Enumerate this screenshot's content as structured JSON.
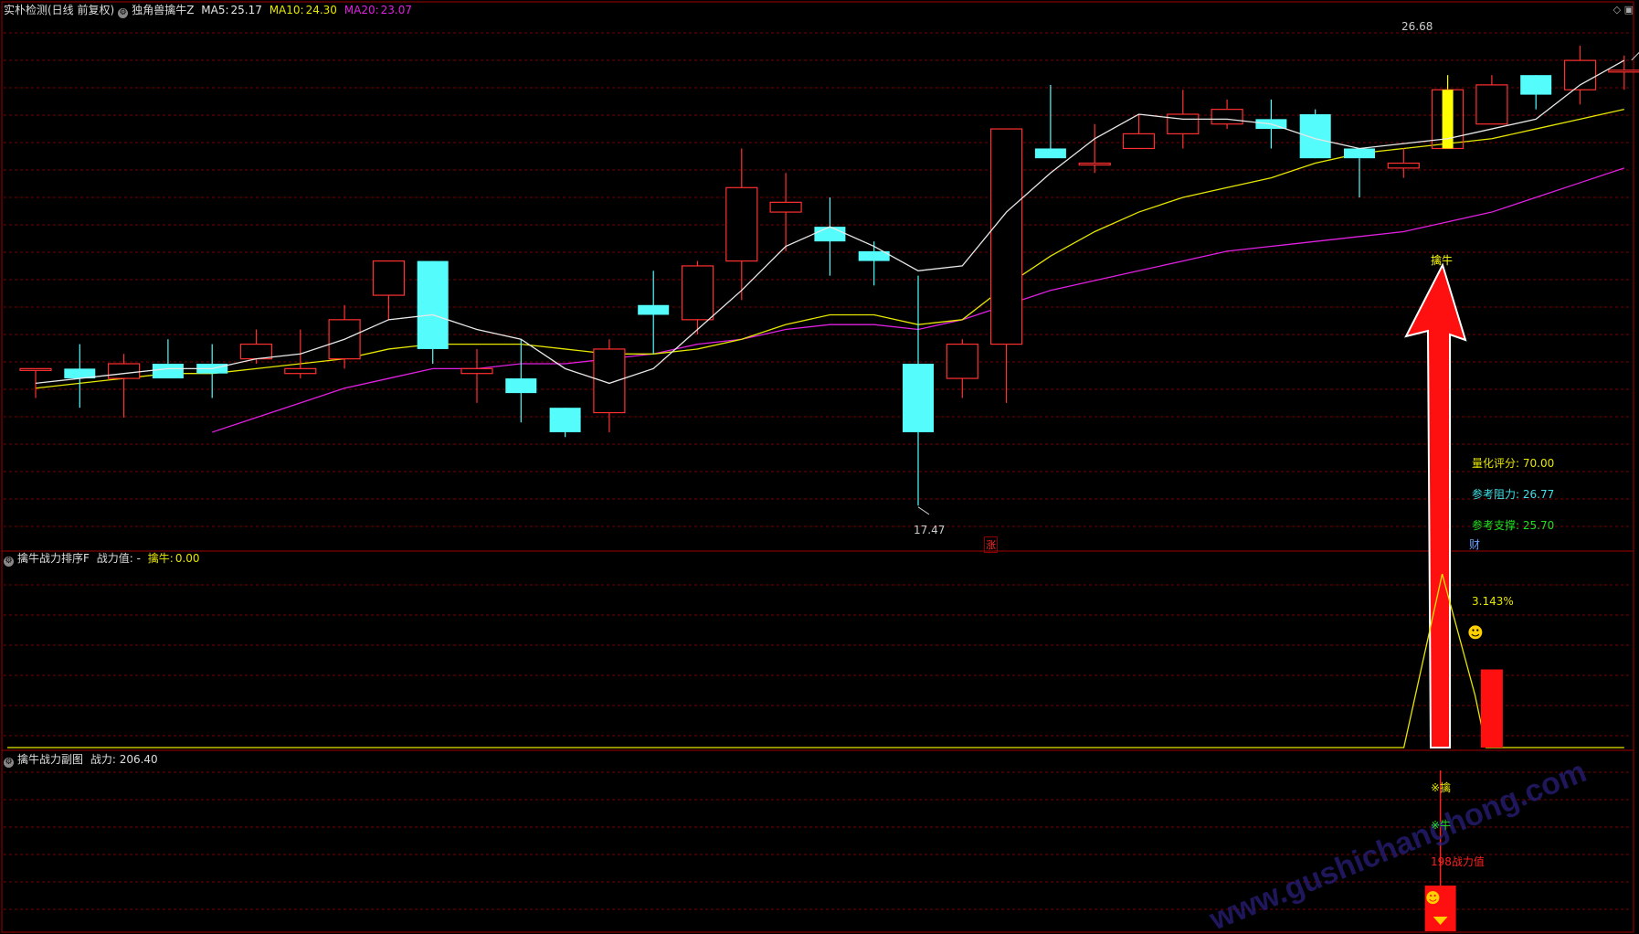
{
  "main_panel": {
    "title": "实朴检测(日线 前复权)",
    "indicator": "独角兽擒牛Z",
    "ma5": {
      "label": "MA5:",
      "value": "25.17",
      "color": "#e8e8e8"
    },
    "ma10": {
      "label": "MA10:",
      "value": "24.30",
      "color": "#e6e600"
    },
    "ma20": {
      "label": "MA20:",
      "value": "23.07",
      "color": "#e020e0"
    },
    "high_label": "26.68",
    "low_label": "17.47",
    "signal_label": "擒牛",
    "stats": [
      {
        "label": "量化评分:",
        "value": "70.00",
        "color": "#e6e600"
      },
      {
        "label": "参考阻力:",
        "value": "26.77",
        "color": "#40e0e8"
      },
      {
        "label": "参考支撑:",
        "value": "25.70",
        "color": "#20e020"
      }
    ],
    "marker_zhang": "涨",
    "marker_cai": "财"
  },
  "panel2": {
    "title": "擒牛战力排序F",
    "field": "战力值: -",
    "qn_label": "擒牛:",
    "qn_value": "0.00",
    "pct": "3.143%",
    "smile": "☻"
  },
  "panel3": {
    "title": "擒牛战力副图",
    "field": "战力: 206.40",
    "t1": "※擒",
    "t2": "※牛",
    "t3": "198战力值",
    "smile": "☻"
  },
  "watermark": "www.gushichanghong.com",
  "colors": {
    "up": "#ff3030",
    "down": "#54fcfc",
    "signal": "#ffff00",
    "grid": "#7a0000"
  },
  "chart_data": {
    "type": "candlestick",
    "ohlc": [
      [
        20.3,
        20.3,
        19.7,
        20.3
      ],
      [
        20.3,
        20.8,
        19.5,
        20.1
      ],
      [
        20.1,
        20.6,
        19.3,
        20.4
      ],
      [
        20.4,
        20.9,
        20.1,
        20.1
      ],
      [
        20.4,
        20.8,
        19.7,
        20.2
      ],
      [
        20.5,
        21.1,
        20.4,
        20.8
      ],
      [
        20.2,
        21.1,
        20.1,
        20.3
      ],
      [
        20.5,
        21.6,
        20.3,
        21.3
      ],
      [
        21.8,
        22.5,
        21.3,
        22.5
      ],
      [
        22.5,
        22.5,
        20.4,
        20.7
      ],
      [
        20.2,
        20.7,
        19.6,
        20.3
      ],
      [
        20.1,
        20.9,
        19.2,
        19.8
      ],
      [
        19.5,
        19.5,
        18.9,
        19.0
      ],
      [
        19.4,
        20.9,
        19.0,
        20.7
      ],
      [
        21.6,
        22.3,
        20.6,
        21.4
      ],
      [
        21.3,
        22.5,
        21.0,
        22.4
      ],
      [
        22.5,
        24.8,
        21.7,
        24.0
      ],
      [
        23.5,
        24.3,
        22.7,
        23.7
      ],
      [
        23.2,
        23.8,
        22.2,
        22.9
      ],
      [
        22.7,
        22.9,
        22.0,
        22.5
      ],
      [
        20.4,
        22.2,
        17.5,
        19.0
      ],
      [
        20.1,
        20.9,
        19.7,
        20.8
      ],
      [
        20.8,
        25.2,
        19.6,
        25.2
      ],
      [
        24.8,
        26.1,
        24.7,
        24.6
      ],
      [
        24.5,
        25.3,
        24.3,
        24.5
      ],
      [
        24.8,
        25.5,
        24.8,
        25.1
      ],
      [
        25.1,
        26.0,
        24.8,
        25.5
      ],
      [
        25.3,
        25.8,
        25.2,
        25.6
      ],
      [
        25.4,
        25.8,
        24.8,
        25.2
      ],
      [
        25.5,
        25.6,
        24.6,
        24.6
      ],
      [
        24.8,
        24.8,
        23.8,
        24.6
      ],
      [
        24.4,
        24.8,
        24.2,
        24.5
      ],
      [
        24.8,
        26.3,
        24.8,
        26.0
      ],
      [
        25.3,
        26.3,
        25.3,
        26.1
      ],
      [
        26.3,
        26.3,
        25.6,
        25.9
      ],
      [
        26.0,
        26.9,
        25.7,
        26.6
      ],
      [
        26.4,
        26.7,
        26.0,
        26.4
      ]
    ],
    "signal_index": 32,
    "ma5": [
      20.0,
      20.1,
      20.2,
      20.3,
      20.3,
      20.5,
      20.6,
      20.9,
      21.3,
      21.4,
      21.1,
      20.9,
      20.3,
      20.0,
      20.3,
      21.1,
      21.9,
      22.8,
      23.2,
      22.8,
      22.3,
      22.4,
      23.5,
      24.3,
      25.0,
      25.5,
      25.4,
      25.4,
      25.3,
      25.0,
      24.8,
      24.9,
      25.0,
      25.2,
      25.4,
      26.1,
      26.6
    ],
    "ma10": [
      19.9,
      20.0,
      20.1,
      20.2,
      20.2,
      20.3,
      20.4,
      20.5,
      20.7,
      20.8,
      20.8,
      20.8,
      20.7,
      20.6,
      20.6,
      20.7,
      20.9,
      21.2,
      21.4,
      21.4,
      21.2,
      21.3,
      22.0,
      22.6,
      23.1,
      23.5,
      23.8,
      24.0,
      24.2,
      24.5,
      24.7,
      24.8,
      24.9,
      25.0,
      25.2,
      25.4,
      25.6
    ],
    "ma20": [
      null,
      null,
      null,
      null,
      19.0,
      19.3,
      19.6,
      19.9,
      20.1,
      20.3,
      20.3,
      20.4,
      20.4,
      20.5,
      20.6,
      20.8,
      20.9,
      21.1,
      21.2,
      21.2,
      21.1,
      21.3,
      21.6,
      21.9,
      22.1,
      22.3,
      22.5,
      22.7,
      22.8,
      22.9,
      23.0,
      23.1,
      23.3,
      23.5,
      23.8,
      24.1,
      24.4
    ],
    "panel2_line": {
      "flat_value": 0,
      "spike_index": 32,
      "spike_value": 1
    },
    "panel2_bar": {
      "index": 33,
      "value": 0.45
    },
    "ylim": [
      17.0,
      27.2
    ]
  }
}
